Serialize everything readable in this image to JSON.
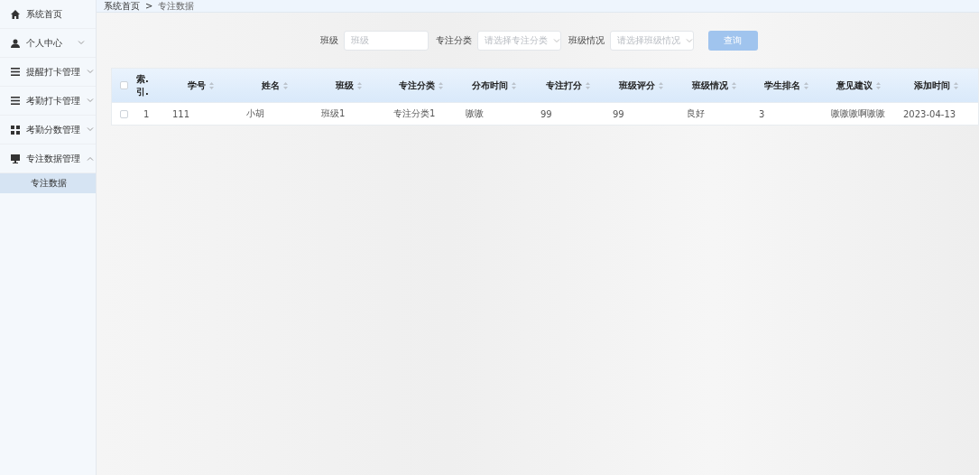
{
  "sidebar": {
    "items": [
      {
        "label": "系统首页",
        "kind": "home"
      },
      {
        "label": "个人中心",
        "kind": "person",
        "expanded": false
      },
      {
        "label": "提醒打卡管理",
        "kind": "list",
        "expanded": false
      },
      {
        "label": "考勤打卡管理",
        "kind": "list",
        "expanded": false
      },
      {
        "label": "考勤分数管理",
        "kind": "grid",
        "expanded": false
      },
      {
        "label": "专注数据管理",
        "kind": "monitor",
        "expanded": true,
        "children": [
          {
            "label": "专注数据",
            "selected": true
          }
        ]
      }
    ]
  },
  "breadcrumb": [
    "系统首页",
    "专注数据"
  ],
  "breadcrumb_separator": ">",
  "filters": [
    {
      "kind": "input",
      "label": "班级",
      "placeholder": "班级"
    },
    {
      "kind": "select",
      "label": "专注分类",
      "placeholder": "请选择专注分类"
    },
    {
      "kind": "select",
      "label": "班级情况",
      "placeholder": "请选择班级情况"
    }
  ],
  "search_button": "查询",
  "table": {
    "columns": [
      {
        "label": "索.引.",
        "sortable": false
      },
      {
        "label": "学号",
        "sortable": true
      },
      {
        "label": "姓名",
        "sortable": true
      },
      {
        "label": "班级",
        "sortable": true
      },
      {
        "label": "专注分类",
        "sortable": true
      },
      {
        "label": "分布时间",
        "sortable": true
      },
      {
        "label": "专注打分",
        "sortable": true
      },
      {
        "label": "班级评分",
        "sortable": true
      },
      {
        "label": "班级情况",
        "sortable": true
      },
      {
        "label": "学生排名",
        "sortable": true
      },
      {
        "label": "意见建议",
        "sortable": true
      },
      {
        "label": "添加时间",
        "sortable": true
      }
    ],
    "all_checked": false,
    "rows": [
      {
        "checked": false,
        "cells": [
          "1",
          "111",
          "小胡",
          "班级1",
          "专注分类1",
          "嗷嗷",
          "99",
          "99",
          "良好",
          "3",
          "嗷嗷嗷啊嗷嗷",
          "2023-04-13"
        ]
      }
    ]
  }
}
